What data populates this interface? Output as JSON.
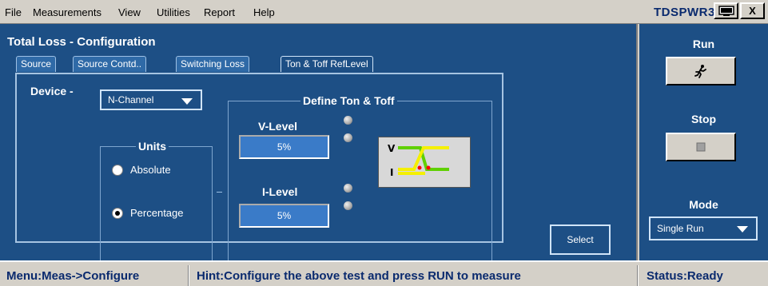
{
  "menu": {
    "items": [
      "File",
      "Measurements",
      "View",
      "Utilities",
      "Report",
      "Help"
    ],
    "underlined_first_letters": [
      "F",
      "M",
      "V",
      "U",
      "R",
      "H"
    ]
  },
  "app": {
    "title": "TDSPWR3",
    "close_label": "X"
  },
  "panel": {
    "title": "Total Loss - Configuration",
    "tabs": [
      {
        "label": "Source",
        "active": false
      },
      {
        "label": "Source Contd..",
        "active": false
      },
      {
        "label": "Switching Loss",
        "active": false
      },
      {
        "label": "Ton & Toff RefLevel",
        "active": true
      }
    ]
  },
  "config": {
    "device_label": "Device -",
    "device_value": "N-Channel",
    "units_group": "Units",
    "units_options": [
      "Absolute",
      "Percentage"
    ],
    "units_selected": "Percentage",
    "define_group": "Define Ton & Toff",
    "v_level_label": "V-Level",
    "v_level_value": "5%",
    "i_level_label": "I-Level",
    "i_level_value": "5%",
    "select_label": "Select",
    "diagram_v": "V",
    "diagram_i": "I"
  },
  "side": {
    "run_label": "Run",
    "stop_label": "Stop",
    "mode_label": "Mode",
    "mode_value": "Single Run"
  },
  "status": {
    "menu": "Menu:Meas->Configure",
    "hint": "Hint:Configure the above test and press RUN to measure",
    "state": "Status:Ready"
  },
  "colors": {
    "panel_bg": "#1d4f85",
    "field_bg": "#3a7bc8",
    "status_text": "#0a2a6e",
    "trace_yellow": "#f5f000",
    "trace_green": "#5fd000",
    "marker_red": "#ff0000"
  },
  "icons": {
    "run": "running-man-icon",
    "stop": "stop-square-icon",
    "maximize": "monitor-icon"
  }
}
